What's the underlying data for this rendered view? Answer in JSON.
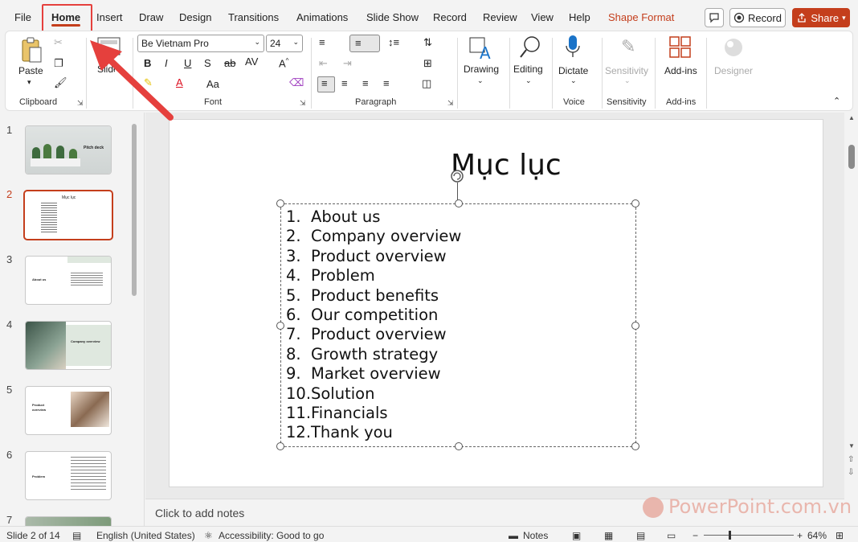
{
  "menu": {
    "tabs": [
      "File",
      "Home",
      "Insert",
      "Draw",
      "Design",
      "Transitions",
      "Animations",
      "Slide Show",
      "Record",
      "Review",
      "View",
      "Help",
      "Shape Format"
    ],
    "record_label": "Record",
    "share_label": "Share"
  },
  "ribbon": {
    "clipboard": {
      "paste_label": "Paste",
      "group_label": "Clipboard"
    },
    "slides": {
      "label": "Slides"
    },
    "font": {
      "family": "Be Vietnam Pro",
      "size": "24",
      "group_label": "Font",
      "bold": "B",
      "italic": "I",
      "underline": "U",
      "strike": "ab",
      "shadow": "S",
      "spacing": "AV",
      "case": "Aa"
    },
    "paragraph": {
      "group_label": "Paragraph"
    },
    "drawing_label": "Drawing",
    "editing_label": "Editing",
    "dictate_label": "Dictate",
    "voice_label": "Voice",
    "sensitivity_label": "Sensitivity",
    "sensitivity_group": "Sensitivity",
    "addins_label": "Add-ins",
    "addins_group": "Add-ins",
    "designer_label": "Designer"
  },
  "thumbnails": [
    {
      "num": "1",
      "caption": "Pitch deck"
    },
    {
      "num": "2",
      "caption": "Mục lục"
    },
    {
      "num": "3",
      "caption": "About us"
    },
    {
      "num": "4",
      "caption": "Company overview"
    },
    {
      "num": "5",
      "caption": "Product overview"
    },
    {
      "num": "6",
      "caption": "Problem"
    },
    {
      "num": "7",
      "caption": ""
    }
  ],
  "slide": {
    "title": "Mục lục",
    "items": [
      {
        "num": "1.",
        "text": "About us"
      },
      {
        "num": "2.",
        "text": "Company overview"
      },
      {
        "num": "3.",
        "text": "Product overview"
      },
      {
        "num": "4.",
        "text": "Problem"
      },
      {
        "num": "5.",
        "text": "Product benefits"
      },
      {
        "num": "6.",
        "text": "Our competition"
      },
      {
        "num": "7.",
        "text": "Product overview"
      },
      {
        "num": "8.",
        "text": "Growth strategy"
      },
      {
        "num": "9.",
        "text": "Market overview"
      },
      {
        "num": "10.",
        "text": "Solution"
      },
      {
        "num": "11.",
        "text": "Financials"
      },
      {
        "num": "12.",
        "text": "Thank you"
      }
    ]
  },
  "notes_placeholder": "Click to add notes",
  "status": {
    "slide_info": "Slide 2 of 14",
    "language": "English (United States)",
    "accessibility": "Accessibility: Good to go",
    "notes_label": "Notes",
    "zoom": "64%"
  },
  "watermark": "PowerPoint.com.vn",
  "colors": {
    "accent": "#c43e1c",
    "highlight_box": "#e5403d",
    "arrow": "#e5403d"
  }
}
